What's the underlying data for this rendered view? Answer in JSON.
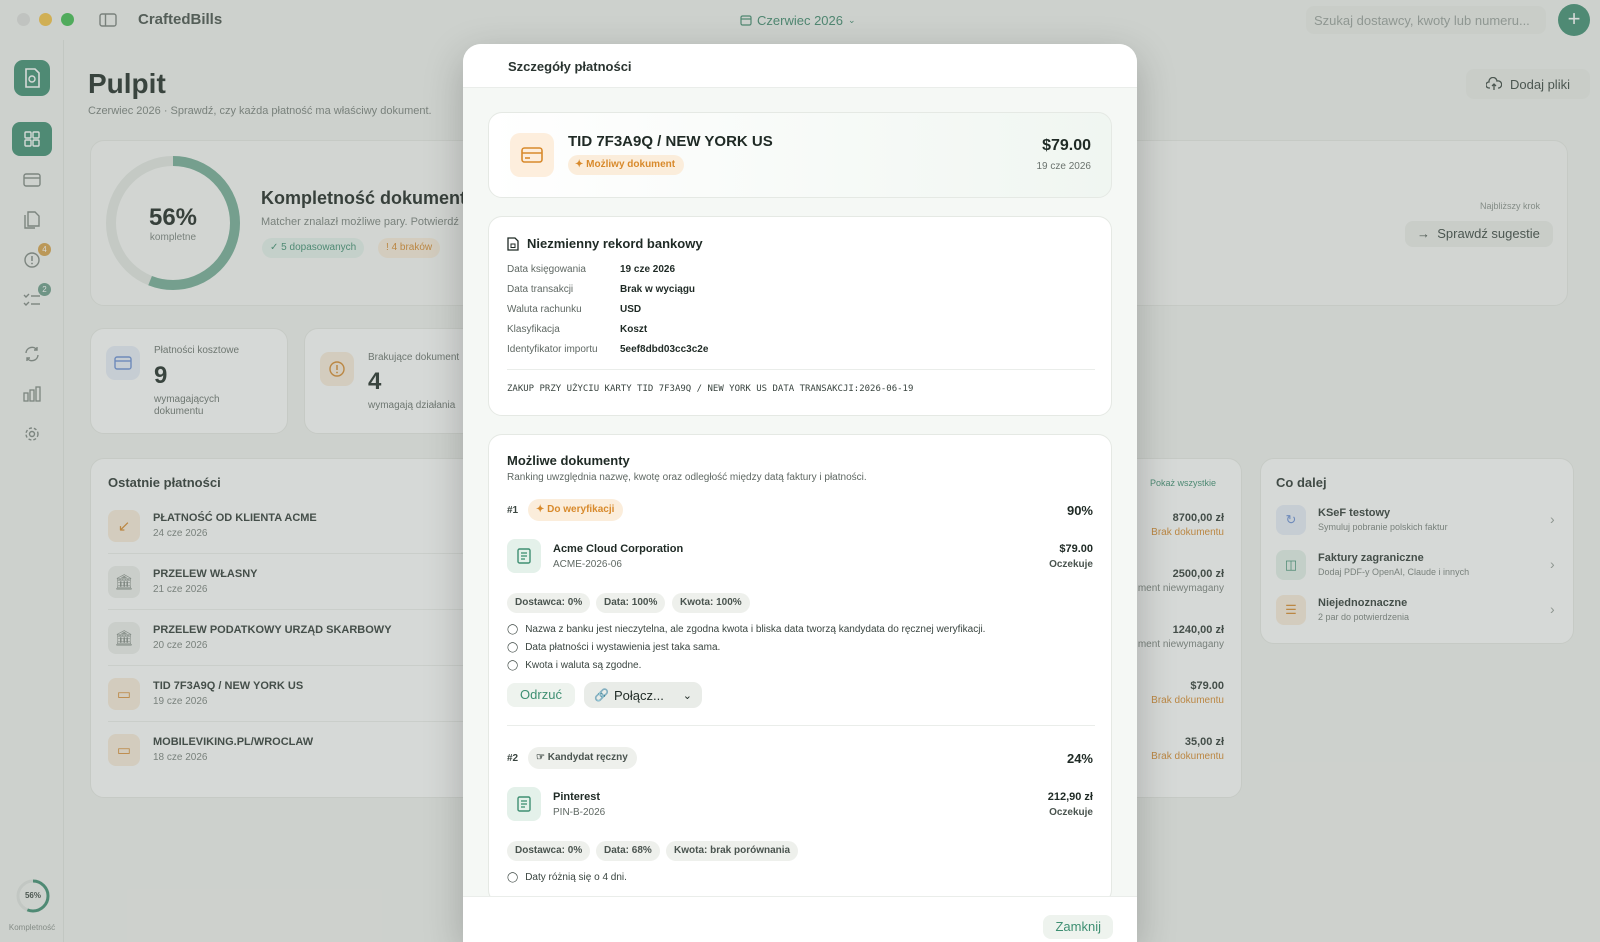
{
  "app": {
    "name": "CraftedBills",
    "month": "Czerwiec 2026",
    "search_placeholder": "Szukaj dostawcy, kwoty lub numeru...",
    "accent": "#3e8f72",
    "warning": "#d88a2c"
  },
  "sidebar": {
    "badges": {
      "alerts": "4",
      "tasks": "2"
    },
    "completeness": "56%",
    "completeness_label": "Kompletność"
  },
  "dashboard": {
    "title": "Pulpit",
    "subtitle": "Czerwiec 2026 · Sprawdź, czy każda płatność ma właściwy dokument.",
    "upload_label": "Dodaj pliki",
    "completeness": {
      "pct": "56%",
      "pct_value": 0.56,
      "caption": "kompletne",
      "title": "Kompletność dokumentów",
      "sub": "Matcher znalazł możliwe pary. Potwierdź",
      "matched": "5 dopasowanych",
      "missing": "4 braków"
    },
    "next_step": {
      "label": "Najbliższy krok",
      "button": "Sprawdź sugestie"
    },
    "kpi": [
      {
        "label": "Płatności kosztowe",
        "value": "9",
        "sub": "wymagających dokumentu"
      },
      {
        "label": "Brakujące dokument",
        "value": "4",
        "sub": "wymagają działania"
      }
    ],
    "recent_title": "Ostatnie płatności",
    "show_all": "Pokaż wszystkie",
    "payments": [
      {
        "name": "PŁATNOŚĆ OD KLIENTA ACME",
        "date": "24 cze 2026",
        "amount": "8700,00 zł",
        "status": "Brak dokumentu"
      },
      {
        "name": "PRZELEW WŁASNY",
        "date": "21 cze 2026",
        "amount": "2500,00 zł",
        "status": "ment niewymagany"
      },
      {
        "name": "PRZELEW PODATKOWY URZĄD SKARBOWY",
        "date": "20 cze 2026",
        "amount": "1240,00 zł",
        "status": "ment niewymagany"
      },
      {
        "name": "TID 7F3A9Q / NEW YORK US",
        "date": "19 cze 2026",
        "amount": "$79.00",
        "status": "Brak dokumentu"
      },
      {
        "name": "MOBILEVIKING.PL/WROCLAW",
        "date": "18 cze 2026",
        "amount": "35,00 zł",
        "status": "Brak dokumentu"
      }
    ],
    "next": {
      "title": "Co dalej",
      "items": [
        {
          "title": "KSeF testowy",
          "sub": "Symuluj pobranie polskich faktur"
        },
        {
          "title": "Faktury zagraniczne",
          "sub": "Dodaj PDF-y OpenAI, Claude i innych"
        },
        {
          "title": "Niejednoznaczne",
          "sub": "2 par do potwierdzenia"
        }
      ]
    }
  },
  "modal": {
    "title": "Szczegóły płatności",
    "transaction": {
      "title": "TID 7F3A9Q / NEW YORK US",
      "badge": "Możliwy dokument",
      "amount": "$79.00",
      "date": "19 cze 2026"
    },
    "bank": {
      "title": "Niezmienny rekord bankowy",
      "rows": [
        {
          "k": "Data księgowania",
          "v": "19 cze 2026"
        },
        {
          "k": "Data transakcji",
          "v": "Brak w wyciągu"
        },
        {
          "k": "Waluta rachunku",
          "v": "USD"
        },
        {
          "k": "Klasyfikacja",
          "v": "Koszt"
        },
        {
          "k": "Identyfikator importu",
          "v": "5eef8dbd03cc3c2e"
        }
      ],
      "raw": "ZAKUP PRZY UŻYCIU KARTY TID 7F3A9Q / NEW YORK US DATA TRANSAKCJI:2026-06-19"
    },
    "docs": {
      "title": "Możliwe dokumenty",
      "sub": "Ranking uwzględnia nazwę, kwotę oraz odległość między datą faktury i płatności.",
      "candidates": [
        {
          "rank": "#1",
          "badge": "Do weryfikacji",
          "score": "90%",
          "vendor": "Acme Cloud Corporation",
          "number": "ACME-2026-06",
          "amount": "$79.00",
          "status": "Oczekuje",
          "chips": [
            "Dostawca: 0%",
            "Data: 100%",
            "Kwota: 100%"
          ],
          "reasons": [
            "Nazwa z banku jest nieczytelna, ale zgodna kwota i bliska data tworzą kandydata do ręcznej weryfikacji.",
            "Data płatności i wystawienia jest taka sama.",
            "Kwota i waluta są zgodne."
          ],
          "reject": "Odrzuć",
          "link": "Połącz..."
        },
        {
          "rank": "#2",
          "badge": "Kandydat ręczny",
          "score": "24%",
          "vendor": "Pinterest",
          "number": "PIN-B-2026",
          "amount": "212,90 zł",
          "status": "Oczekuje",
          "chips": [
            "Dostawca: 0%",
            "Data: 68%",
            "Kwota: brak porównania"
          ],
          "reasons": [
            "Daty różnią się o 4 dni."
          ]
        }
      ]
    },
    "close": "Zamknij"
  }
}
